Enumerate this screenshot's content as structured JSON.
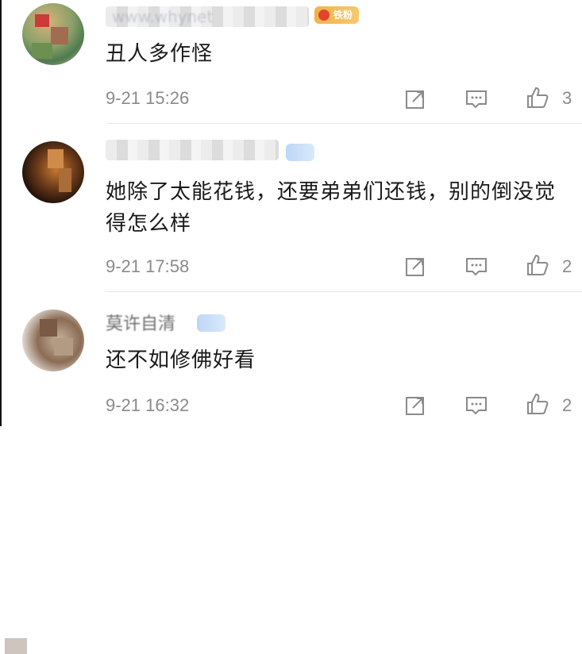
{
  "comments": [
    {
      "username": "www.whynet",
      "badge": "铁粉",
      "text": "丑人多作怪",
      "time": "9-21 15:26",
      "likes": "3",
      "avatar_icon": "user-avatar"
    },
    {
      "username": "",
      "badge": "",
      "text": "她除了太能花钱，还要弟弟们还钱，别的倒没觉得怎么样",
      "time": "9-21 17:58",
      "likes": "2",
      "avatar_icon": "user-avatar"
    },
    {
      "username": "莫许自清",
      "badge": "",
      "text": "还不如修佛好看",
      "time": "9-21 16:32",
      "likes": "2",
      "avatar_icon": "user-avatar"
    }
  ],
  "icons": {
    "share": "share-icon",
    "comment": "comment-icon",
    "like": "thumbs-up-icon"
  },
  "colors": {
    "text": "#1a1a1a",
    "meta": "#8a8a8a",
    "fan_badge": "#f3b24a",
    "vip_badge": "#bcd7f6"
  }
}
